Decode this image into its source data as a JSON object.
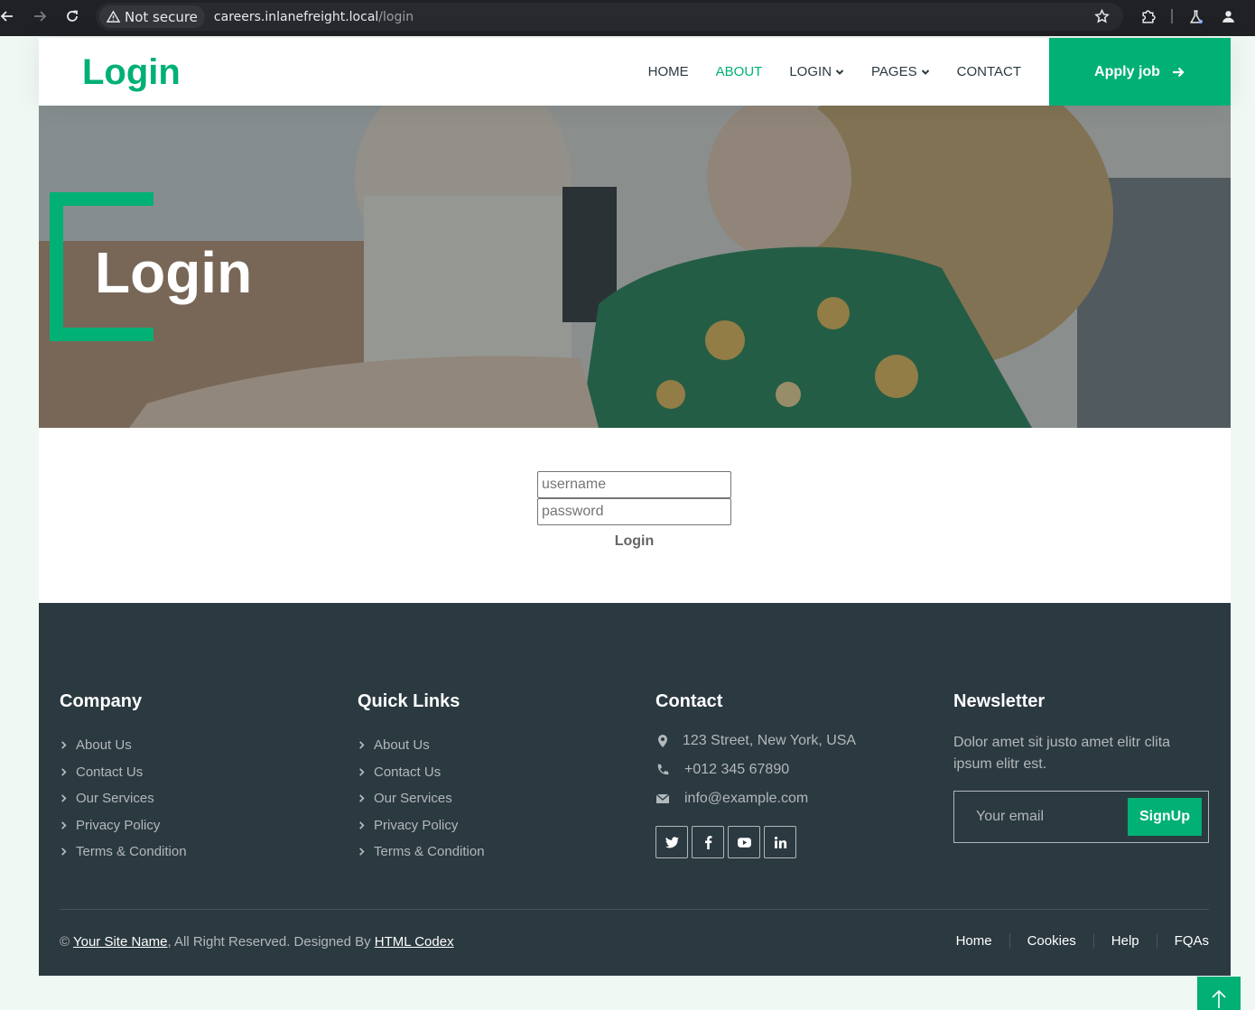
{
  "browser": {
    "security_label": "Not secure",
    "url_host": "careers.inlanefreight.local",
    "url_path": "/login"
  },
  "navbar": {
    "brand": "Login",
    "items": [
      {
        "label": "HOME"
      },
      {
        "label": "ABOUT",
        "active": true
      },
      {
        "label": "LOGIN",
        "dropdown": true
      },
      {
        "label": "PAGES",
        "dropdown": true
      },
      {
        "label": "CONTACT"
      }
    ],
    "apply_label": "Apply job"
  },
  "hero": {
    "title": "Login"
  },
  "login": {
    "username_placeholder": "username",
    "password_placeholder": "password",
    "button_label": "Login"
  },
  "footer": {
    "company": {
      "title": "Company",
      "links": [
        "About Us",
        "Contact Us",
        "Our Services",
        "Privacy Policy",
        "Terms & Condition"
      ]
    },
    "quick_links": {
      "title": "Quick Links",
      "links": [
        "About Us",
        "Contact Us",
        "Our Services",
        "Privacy Policy",
        "Terms & Condition"
      ]
    },
    "contact": {
      "title": "Contact",
      "address": "123 Street, New York, USA",
      "phone": "+012 345 67890",
      "email": "info@example.com",
      "socials": [
        "twitter-icon",
        "facebook-icon",
        "youtube-icon",
        "linkedin-icon"
      ]
    },
    "newsletter": {
      "title": "Newsletter",
      "text": "Dolor amet sit justo amet elitr clita ipsum elitr est.",
      "email_placeholder": "Your email",
      "button_label": "SignUp"
    },
    "copyright": {
      "symbol": "©",
      "site_name": "Your Site Name",
      "middle": ", All Right Reserved. Designed By ",
      "designer": "HTML Codex"
    },
    "bottom_menu": [
      "Home",
      "Cookies",
      "Help",
      "FQAs"
    ]
  },
  "colors": {
    "accent": "#00b074",
    "dark": "#2b3940",
    "page_bg": "#eff8f3"
  }
}
